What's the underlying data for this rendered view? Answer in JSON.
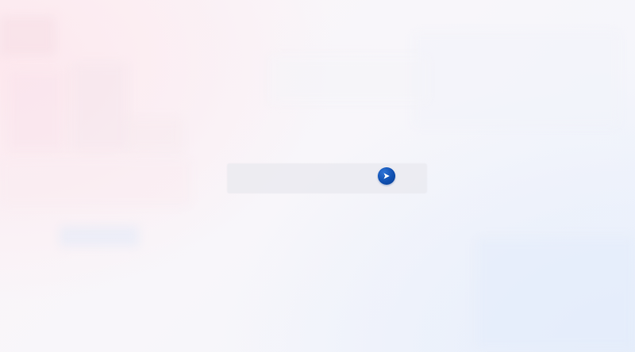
{
  "page": {
    "background_tones": {
      "pink": "#fde8ee",
      "blue": "#e6eefb",
      "base": "#f8f6fa"
    }
  },
  "search": {
    "placeholder": "",
    "value": "",
    "bar_color": "#e8e8ee"
  },
  "submit": {
    "icon": "play-arrow-icon",
    "color": "#0f4fb0",
    "icon_color": "#ffffff"
  }
}
